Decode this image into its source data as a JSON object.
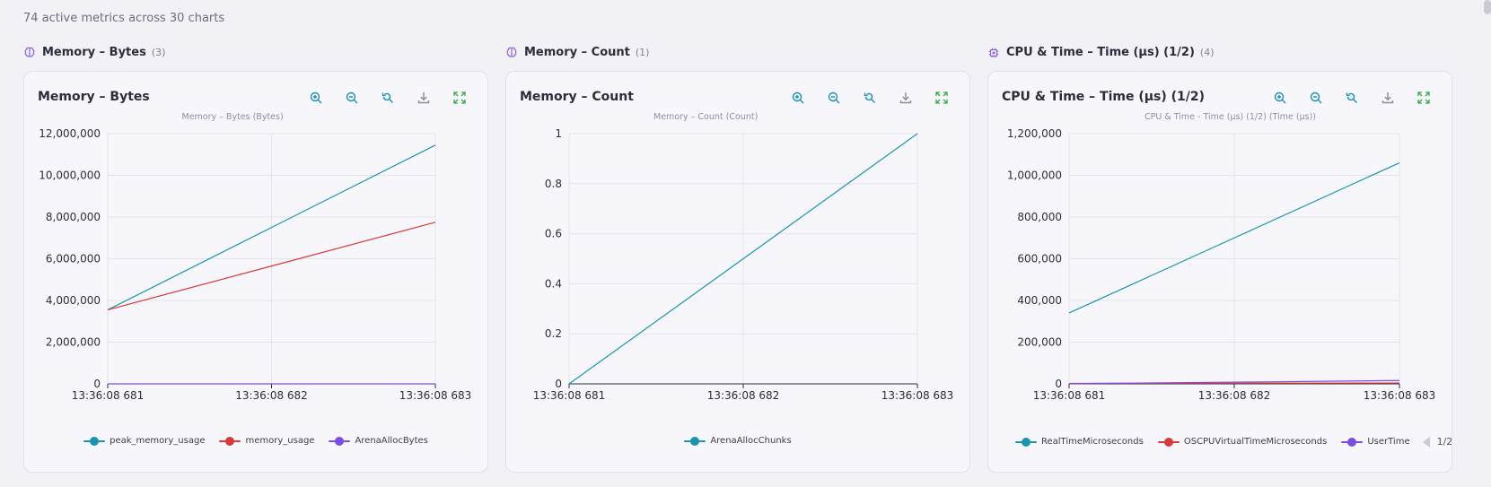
{
  "summary": "74 active metrics across 30 charts",
  "groups": [
    {
      "title": "Memory – Bytes",
      "count": "(3)"
    },
    {
      "title": "Memory – Count",
      "count": "(1)"
    },
    {
      "title": "CPU & Time – Time (µs) (1/2)",
      "count": "(4)"
    }
  ],
  "toolbar_icons": [
    "zoom-in-icon",
    "zoom-out-icon",
    "zoom-reset-icon",
    "download-icon",
    "fullscreen-icon"
  ],
  "colors": {
    "toolbar_blue": "#1a8fb3",
    "fullscreen_green": "#35a845",
    "download_gray": "#8a8d99"
  },
  "charts": [
    {
      "title": "Memory – Bytes",
      "chart_data": {
        "type": "line",
        "title": "Memory – Bytes (Bytes)",
        "x": [
          "13:36:08 681",
          "13:36:08 682",
          "13:36:08 683"
        ],
        "ylim": [
          0,
          12000000
        ],
        "yticks": [
          "0",
          "2,000,000",
          "4,000,000",
          "6,000,000",
          "8,000,000",
          "10,000,000",
          "12,000,000"
        ],
        "grid": true,
        "legend": "bottom",
        "series": [
          {
            "name": "peak_memory_usage",
            "color": "#1a95ad",
            "values": [
              3550000,
              7500000,
              11450000
            ]
          },
          {
            "name": "memory_usage",
            "color": "#d63a3a",
            "values": [
              3550000,
              5650000,
              7750000
            ]
          },
          {
            "name": "ArenaAllocBytes",
            "color": "#7b4ce0",
            "values": [
              0,
              0,
              0
            ]
          }
        ]
      }
    },
    {
      "title": "Memory – Count",
      "chart_data": {
        "type": "line",
        "title": "Memory – Count (Count)",
        "x": [
          "13:36:08 681",
          "13:36:08 682",
          "13:36:08 683"
        ],
        "ylim": [
          0,
          1
        ],
        "yticks": [
          "0",
          "0.2",
          "0.4",
          "0.6",
          "0.8",
          "1"
        ],
        "grid": true,
        "legend": "bottom",
        "series": [
          {
            "name": "ArenaAllocChunks",
            "color": "#1a95ad",
            "values": [
              0,
              0.5,
              1
            ]
          }
        ]
      }
    },
    {
      "title": "CPU & Time – Time (µs) (1/2)",
      "chart_data": {
        "type": "line",
        "title": "CPU & Time - Time (µs) (1/2) (Time (µs))",
        "x": [
          "13:36:08 681",
          "13:36:08 682",
          "13:36:08 683"
        ],
        "ylim": [
          0,
          1200000
        ],
        "yticks": [
          "0",
          "200,000",
          "400,000",
          "600,000",
          "800,000",
          "1,000,000",
          "1,200,000"
        ],
        "grid": true,
        "legend": "bottom",
        "legend_page": "1/2",
        "series": [
          {
            "name": "RealTimeMicroseconds",
            "color": "#1a95ad",
            "values": [
              340000,
              700000,
              1060000
            ]
          },
          {
            "name": "OSCPUVirtualTimeMicroseconds",
            "color": "#d63a3a",
            "values": [
              2000,
              3000,
              4000
            ]
          },
          {
            "name": "UserTime",
            "color": "#7b4ce0",
            "values": [
              1000,
              8000,
              16000
            ]
          }
        ]
      }
    }
  ]
}
